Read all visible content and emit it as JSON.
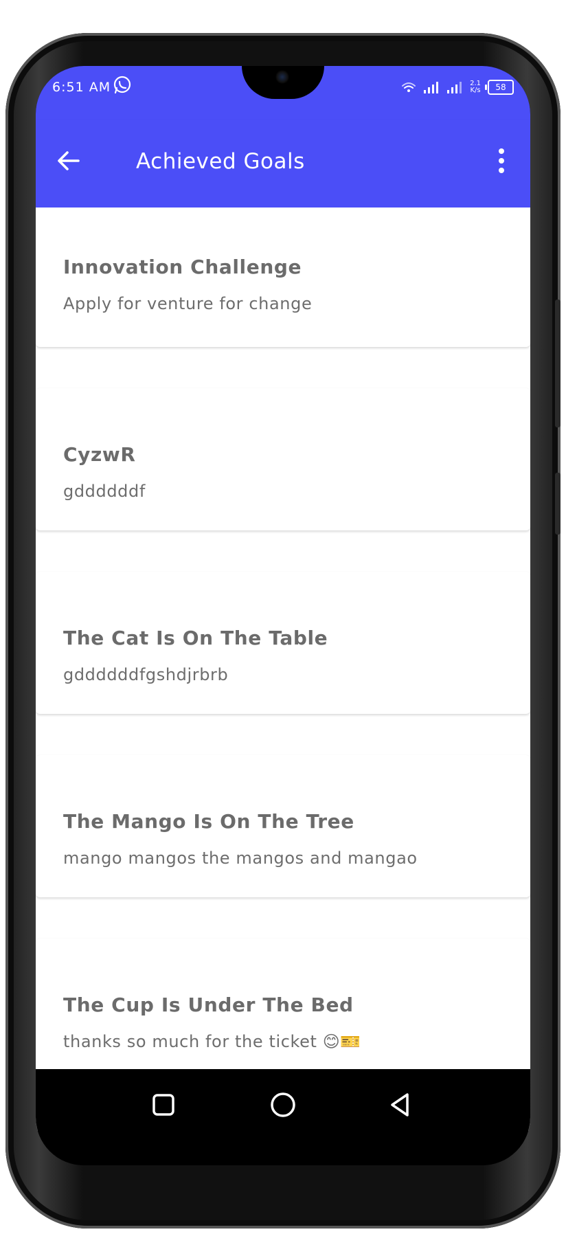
{
  "status_bar": {
    "time": "6:51 AM",
    "network_speed_value": "2.1",
    "network_speed_unit": "K/s",
    "battery": "58",
    "icons": [
      "whatsapp-icon",
      "wifi-icon",
      "signal-icon",
      "signal-icon",
      "battery-icon"
    ]
  },
  "app_bar": {
    "title": "Achieved Goals",
    "back_icon": "arrow-left-icon",
    "menu_icon": "more-vertical-icon",
    "color": "#4b4ef7"
  },
  "goals": [
    {
      "title": "Innovation Challenge",
      "description": "Apply for venture for change"
    },
    {
      "title": "CyzwR",
      "description": "gddddddf"
    },
    {
      "title": "The Cat Is On The Table",
      "description": "gddddddfgshdjrbrb"
    },
    {
      "title": "The Mango Is On The Tree",
      "description": "mango mangos the mangos and mangao"
    },
    {
      "title": "The Cup Is Under The Bed",
      "description": "thanks so much for the ticket 😊🎫"
    }
  ],
  "nav_bar": {
    "icons": [
      "square-recents-icon",
      "circle-home-icon",
      "triangle-back-icon"
    ]
  }
}
